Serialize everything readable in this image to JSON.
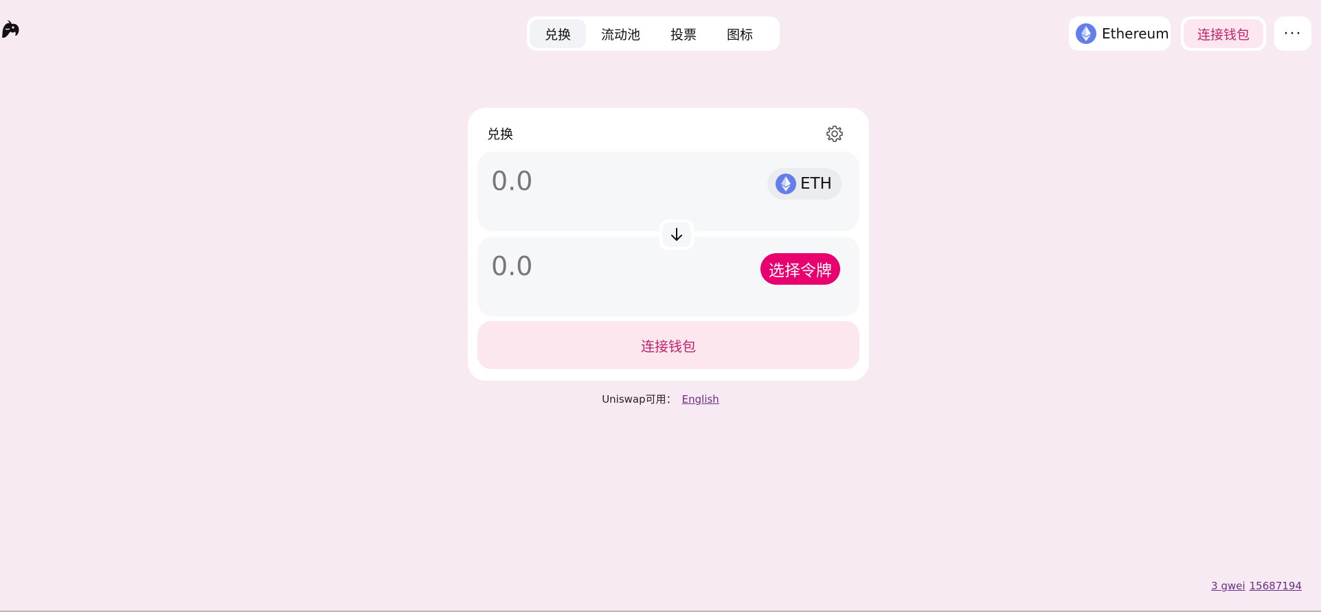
{
  "header": {
    "logo_icon": "unicorn-icon",
    "nav_tabs": [
      {
        "label": "兑换",
        "active": true
      },
      {
        "label": "流动池",
        "active": false
      },
      {
        "label": "投票",
        "active": false
      },
      {
        "label": "图标",
        "active": false
      }
    ],
    "network": {
      "label": "Ethereum",
      "icon": "ethereum-icon"
    },
    "connect_wallet_label": "连接钱包",
    "more_label": "···"
  },
  "swap": {
    "title": "兑换",
    "settings_icon": "gear-icon",
    "input": {
      "placeholder": "0.0",
      "token_label": "ETH",
      "token_icon": "ethereum-icon"
    },
    "output": {
      "placeholder": "0.0",
      "select_token_label": "选择令牌"
    },
    "switch_icon": "arrow-down-icon",
    "connect_wallet_label": "连接钱包"
  },
  "language": {
    "prefix": "Uniswap可用：",
    "link_label": "English"
  },
  "footer": {
    "gas": "3 gwei",
    "block": "15687194"
  },
  "colors": {
    "background": "#f7eaf3",
    "accent_pink": "#e8006f",
    "connect_text": "#c3216b",
    "connect_bg": "#fce7ee",
    "ethereum": "#627eea",
    "link": "#6b2c86"
  }
}
